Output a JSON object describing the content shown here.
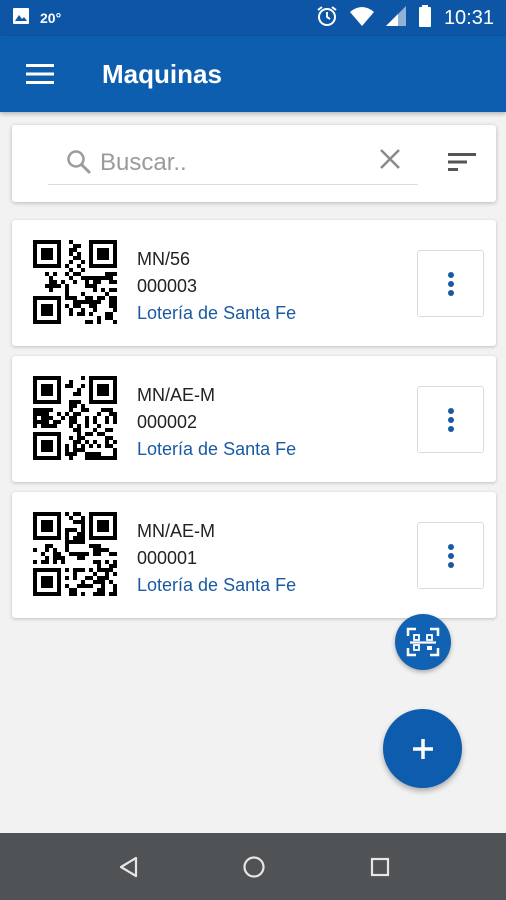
{
  "status_bar": {
    "temperature": "20°",
    "time": "10:31"
  },
  "app_bar": {
    "title": "Maquinas",
    "menu_icon": "hamburger-menu-icon"
  },
  "search": {
    "placeholder": "Buscar..",
    "value": "",
    "search_icon": "search-icon",
    "clear_icon": "close-icon",
    "sort_icon": "sort-icon"
  },
  "machines": [
    {
      "code": "MN/56",
      "serial": "000003",
      "organization": "Lotería de Santa Fe"
    },
    {
      "code": "MN/AE-M",
      "serial": "000002",
      "organization": "Lotería de Santa Fe"
    },
    {
      "code": "MN/AE-M",
      "serial": "000001",
      "organization": "Lotería de Santa Fe"
    }
  ],
  "fabs": {
    "scan_icon": "qr-scan-icon",
    "add_icon": "plus-icon"
  },
  "nav_bar": {
    "back_icon": "back-triangle-icon",
    "home_icon": "home-circle-icon",
    "recents_icon": "recents-square-icon"
  },
  "colors": {
    "primary": "#0e5eb0",
    "status_bar": "#0d56a6",
    "accent_text": "#1a5aa3",
    "background": "#f2f2f2",
    "nav_bar": "#4f5355"
  }
}
